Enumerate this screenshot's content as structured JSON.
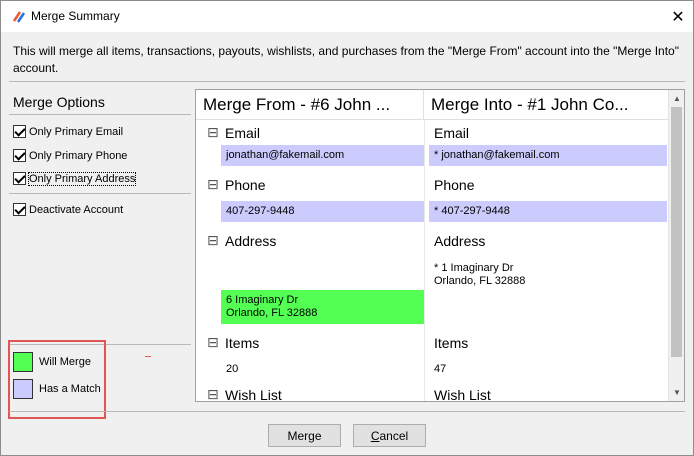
{
  "window": {
    "title": "Merge Summary",
    "close_glyph": "✕",
    "app_icon": "app-logo-icon"
  },
  "description": "This will merge all items, transactions, payouts, wishlists, and purchases from the \"Merge From\" account into the \"Merge Into\" account.",
  "options": {
    "title": "Merge Options",
    "items": [
      {
        "label": "Only Primary Email",
        "checked": true
      },
      {
        "label": "Only Primary Phone",
        "checked": true
      },
      {
        "label": "Only Primary Address",
        "checked": true
      },
      {
        "label": "Deactivate Account",
        "checked": true
      }
    ]
  },
  "legend": {
    "will_merge": {
      "label": "Will Merge",
      "color": "#53ff53"
    },
    "has_match": {
      "label": "Has a Match",
      "color": "#cccbfd"
    }
  },
  "grid": {
    "col_from": "Merge From - #6 John ...",
    "col_into": "Merge Into - #1 John Co...",
    "collapse_glyph": "⊟",
    "sections": {
      "email": {
        "label": "Email",
        "from": "jonathan@fakemail.com",
        "into": "* jonathan@fakemail.com"
      },
      "phone": {
        "label": "Phone",
        "from": "407-297-9448",
        "into": "* 407-297-9448"
      },
      "address": {
        "label": "Address",
        "from_line1": "6 Imaginary Dr",
        "from_line2": "Orlando, FL  32888",
        "into_line1": "* 1 Imaginary Dr",
        "into_line2": "Orlando, FL  32888"
      },
      "items": {
        "label": "Items",
        "from": "20",
        "into": "47"
      },
      "wishlist": {
        "label": "Wish List"
      }
    }
  },
  "buttons": {
    "merge": "Merge",
    "cancel_underlined": "C",
    "cancel_rest": "ancel"
  },
  "colors": {
    "highlight_box": "#e05555"
  }
}
